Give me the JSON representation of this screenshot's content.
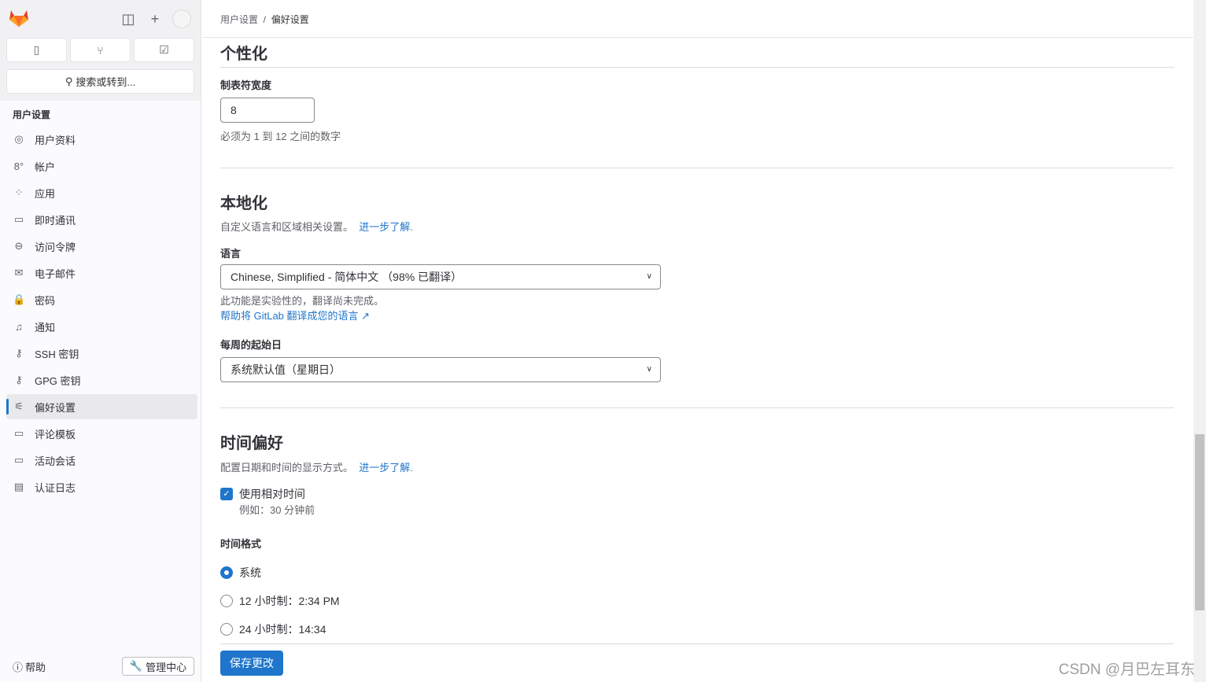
{
  "sidebar": {
    "search_placeholder": "搜索或转到...",
    "section_title": "用户设置",
    "items": [
      {
        "label": "用户资料",
        "icon": "user-icon",
        "glyph": "◎"
      },
      {
        "label": "帐户",
        "icon": "account-icon",
        "glyph": "8°"
      },
      {
        "label": "应用",
        "icon": "applications-icon",
        "glyph": "⁘"
      },
      {
        "label": "即时通讯",
        "icon": "chat-icon",
        "glyph": "▭"
      },
      {
        "label": "访问令牌",
        "icon": "token-icon",
        "glyph": "⊖"
      },
      {
        "label": "电子邮件",
        "icon": "mail-icon",
        "glyph": "✉"
      },
      {
        "label": "密码",
        "icon": "lock-icon",
        "glyph": "🔒"
      },
      {
        "label": "通知",
        "icon": "bell-icon",
        "glyph": "♫"
      },
      {
        "label": "SSH 密钥",
        "icon": "key-icon",
        "glyph": "⚷"
      },
      {
        "label": "GPG 密钥",
        "icon": "key-icon",
        "glyph": "⚷"
      },
      {
        "label": "偏好设置",
        "icon": "preferences-icon",
        "glyph": "⚟"
      },
      {
        "label": "评论模板",
        "icon": "comment-icon",
        "glyph": "▭"
      },
      {
        "label": "活动会话",
        "icon": "monitor-icon",
        "glyph": "▭"
      },
      {
        "label": "认证日志",
        "icon": "log-icon",
        "glyph": "▤"
      }
    ],
    "help": "帮助",
    "admin": "管理中心"
  },
  "breadcrumb": {
    "parent": "用户设置",
    "current": "偏好设置"
  },
  "personalization": {
    "title": "个性化",
    "tab_label": "制表符宽度",
    "tab_value": "8",
    "tab_hint": "必须为 1 到 12 之间的数字"
  },
  "localization": {
    "title": "本地化",
    "desc": "自定义语言和区域相关设置。",
    "learn_more": "进一步了解.",
    "language_label": "语言",
    "language_value": "Chinese, Simplified - 简体中文 （98% 已翻译）",
    "experimental": "此功能是实验性的，翻译尚未完成。",
    "help_translate": "帮助将 GitLab 翻译成您的语言",
    "week_label": "每周的起始日",
    "week_value": "系统默认值（星期日）"
  },
  "time": {
    "title": "时间偏好",
    "desc": "配置日期和时间的显示方式。",
    "learn_more": "进一步了解.",
    "relative_label": "使用相对时间",
    "relative_checked": true,
    "relative_example": "例如：30 分钟前",
    "format_label": "时间格式",
    "options": [
      {
        "label": "系统",
        "selected": true
      },
      {
        "label": "12 小时制：2:34 PM",
        "selected": false
      },
      {
        "label": "24 小时制：14:34",
        "selected": false
      }
    ]
  },
  "save": "保存更改",
  "watermark": "CSDN @月巴左耳东",
  "colors": {
    "accent": "#1f75cb"
  }
}
